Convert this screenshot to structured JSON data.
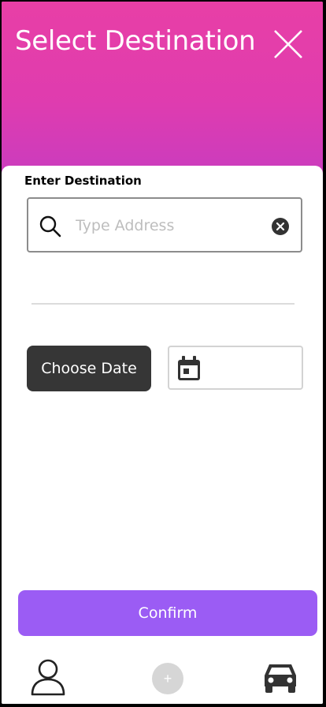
{
  "header": {
    "title": "Select Destination",
    "close_icon": "close-icon",
    "gradient_colors": [
      "#e83fa6",
      "#c83cc0"
    ]
  },
  "destination": {
    "label": "Enter Destination",
    "placeholder": "Type Address",
    "value": "",
    "search_icon": "search-icon",
    "clear_icon": "clear-icon"
  },
  "date": {
    "button_label": "Choose Date",
    "value": "",
    "calendar_icon": "calendar-icon"
  },
  "confirm": {
    "label": "Confirm",
    "color": "#9b5cf4"
  },
  "bottom_nav": {
    "profile_icon": "user-icon",
    "add_label": "+",
    "car_icon": "car-icon"
  }
}
